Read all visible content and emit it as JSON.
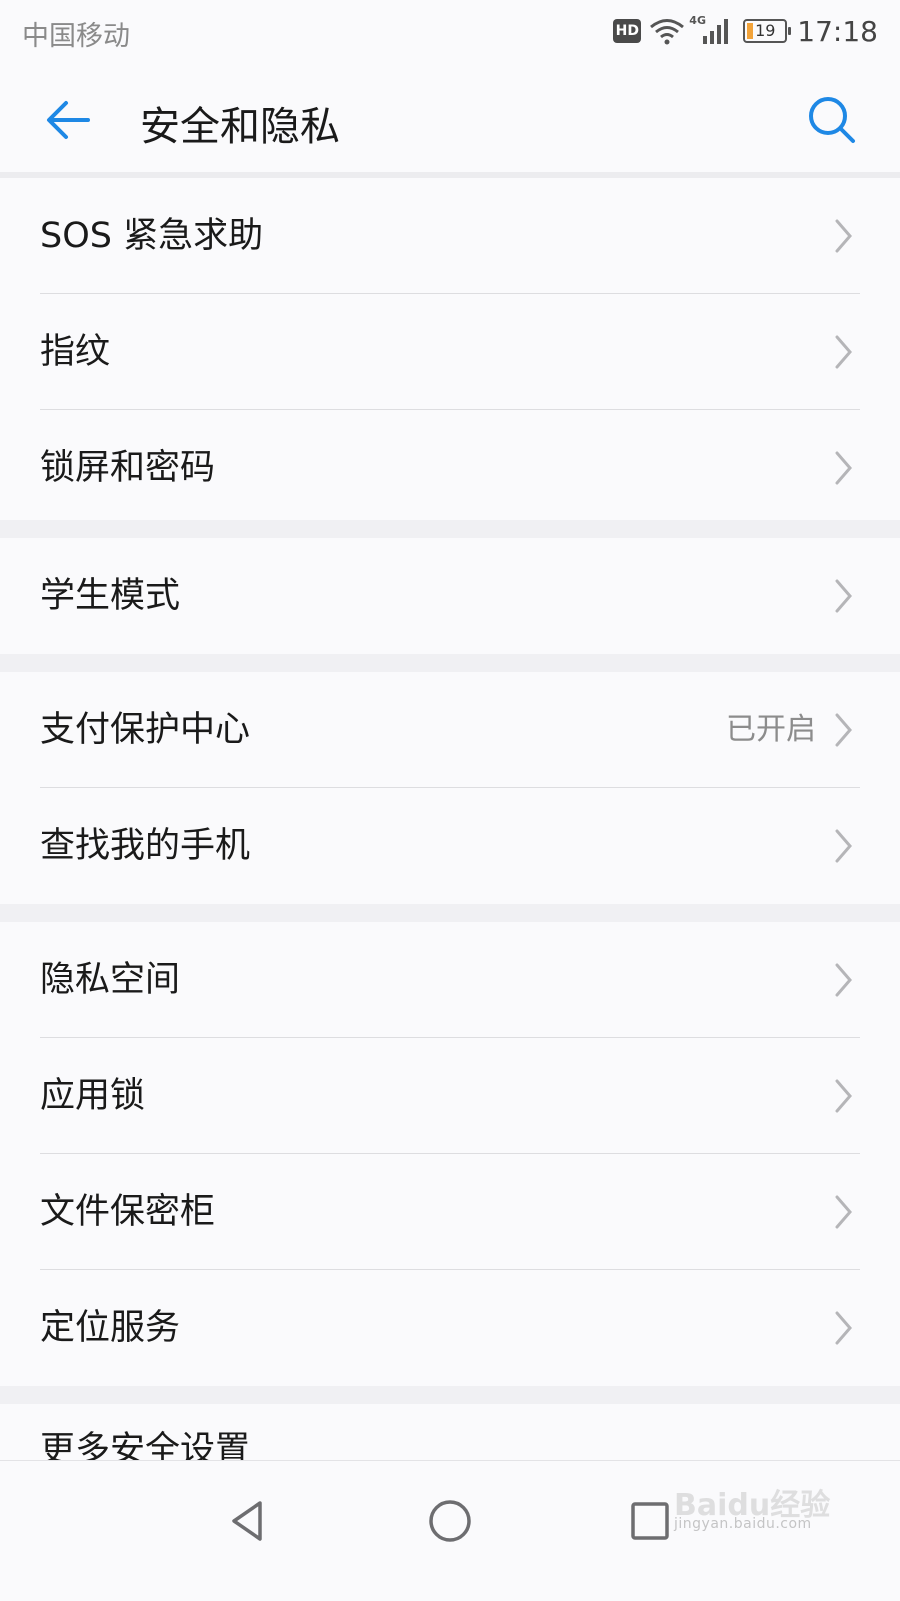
{
  "status_bar": {
    "carrier": "中国移动",
    "hd": "HD",
    "network": "4G",
    "battery": "19",
    "time": "17:18"
  },
  "header": {
    "title": "安全和隐私",
    "back_icon": "arrow-left-icon",
    "search_icon": "search-icon"
  },
  "groups": [
    {
      "items": [
        {
          "label": "SOS 紧急求助"
        },
        {
          "label": "指纹"
        },
        {
          "label": "锁屏和密码"
        }
      ]
    },
    {
      "items": [
        {
          "label": "学生模式"
        }
      ]
    },
    {
      "items": [
        {
          "label": "支付保护中心",
          "value": "已开启"
        },
        {
          "label": "查找我的手机"
        }
      ]
    },
    {
      "items": [
        {
          "label": "隐私空间"
        },
        {
          "label": "应用锁"
        },
        {
          "label": "文件保密柜"
        },
        {
          "label": "定位服务"
        }
      ]
    },
    {
      "items": [
        {
          "label": "更多安全设置"
        }
      ]
    }
  ],
  "watermark": {
    "logo": "Baidu经验",
    "url": "jingyan.baidu.com"
  },
  "colors": {
    "accent": "#1e88e5",
    "background": "#fafafc",
    "gap": "#f0f0f3"
  }
}
